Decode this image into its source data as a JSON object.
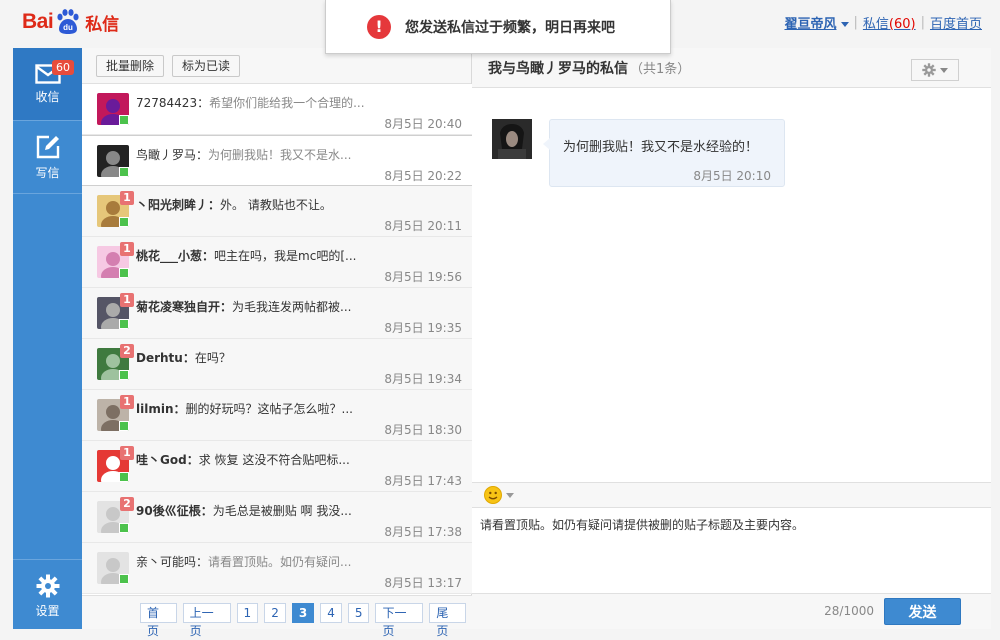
{
  "app": {
    "logo_prefix": "Bai",
    "logo_paw_text": "du",
    "logo_suffix": "私信"
  },
  "toast": {
    "message": "您发送私信过于频繁，明日再来吧"
  },
  "topnav": {
    "username": "翟亘帝风",
    "messages_label": "私信",
    "messages_count": "(60)",
    "home_label": "百度首页"
  },
  "nav": {
    "inbox": {
      "label": "收信",
      "badge": "60"
    },
    "compose": {
      "label": "写信"
    },
    "settings": {
      "label": "设置"
    }
  },
  "list": {
    "toolbar": {
      "delete_label": "批量删除",
      "mark_read_label": "标为已读"
    },
    "conversations": [
      {
        "name": "72784423",
        "sep": "：",
        "preview": "希望你们能给我一个合理的...",
        "time": "8月5日 20:40",
        "unread": "",
        "read": true
      },
      {
        "name": "鸟瞰丿罗马",
        "sep": "：",
        "preview": "为何删我贴！我又不是水...",
        "time": "8月5日 20:22",
        "unread": "",
        "read": true
      },
      {
        "name": "丶阳光刺眸丿",
        "sep": "：",
        "preview": "外。 请教贴也不让。",
        "time": "8月5日 20:11",
        "unread": "1",
        "read": false
      },
      {
        "name": "桃花___小葱",
        "sep": "：",
        "preview": "吧主在吗，我是mc吧的[...",
        "time": "8月5日 19:56",
        "unread": "1",
        "read": false
      },
      {
        "name": "菊花凌寒独自开",
        "sep": "：",
        "preview": "为毛我连发两帖都被...",
        "time": "8月5日 19:35",
        "unread": "1",
        "read": false
      },
      {
        "name": "Derhtu",
        "sep": "：",
        "preview": "在吗？",
        "time": "8月5日 19:34",
        "unread": "2",
        "read": false
      },
      {
        "name": "lilmin",
        "sep": "：",
        "preview": "删的好玩吗？这帖子怎么啦？...",
        "time": "8月5日 18:30",
        "unread": "1",
        "read": false
      },
      {
        "name": "哇丶God",
        "sep": "：",
        "preview": "求 恢复 这没不符合贴吧标...",
        "time": "8月5日 17:43",
        "unread": "1",
        "read": false
      },
      {
        "name": "90後巛征棖",
        "sep": "：",
        "preview": "为毛总是被删贴 啊 我没...",
        "time": "8月5日 17:38",
        "unread": "2",
        "read": false
      },
      {
        "name": "亲丶可能吗",
        "sep": "：",
        "preview": "请看置顶贴。如仍有疑问...",
        "time": "8月5日 13:17",
        "unread": "",
        "read": true
      }
    ],
    "pager": {
      "first": "首页",
      "prev": "上一页",
      "pages": [
        "1",
        "2",
        "3",
        "4",
        "5"
      ],
      "current": "3",
      "next": "下一页",
      "last": "尾页"
    }
  },
  "chat": {
    "title": "我与鸟瞰丿罗马的私信",
    "count_text": "（共1条）",
    "message": {
      "text": "为何删我贴！我又不是水经验的！",
      "time": "8月5日 20:10"
    },
    "compose_value": "请看置顶贴。如仍有疑问请提供被删的贴子标题及主要内容。",
    "counter": "28/1000",
    "send_label": "发送"
  },
  "colors": {
    "nav_blue": "#3e8ad1",
    "brand_red": "#de2a18",
    "badge_red": "#e74c3c",
    "online_green": "#4cc24c"
  }
}
